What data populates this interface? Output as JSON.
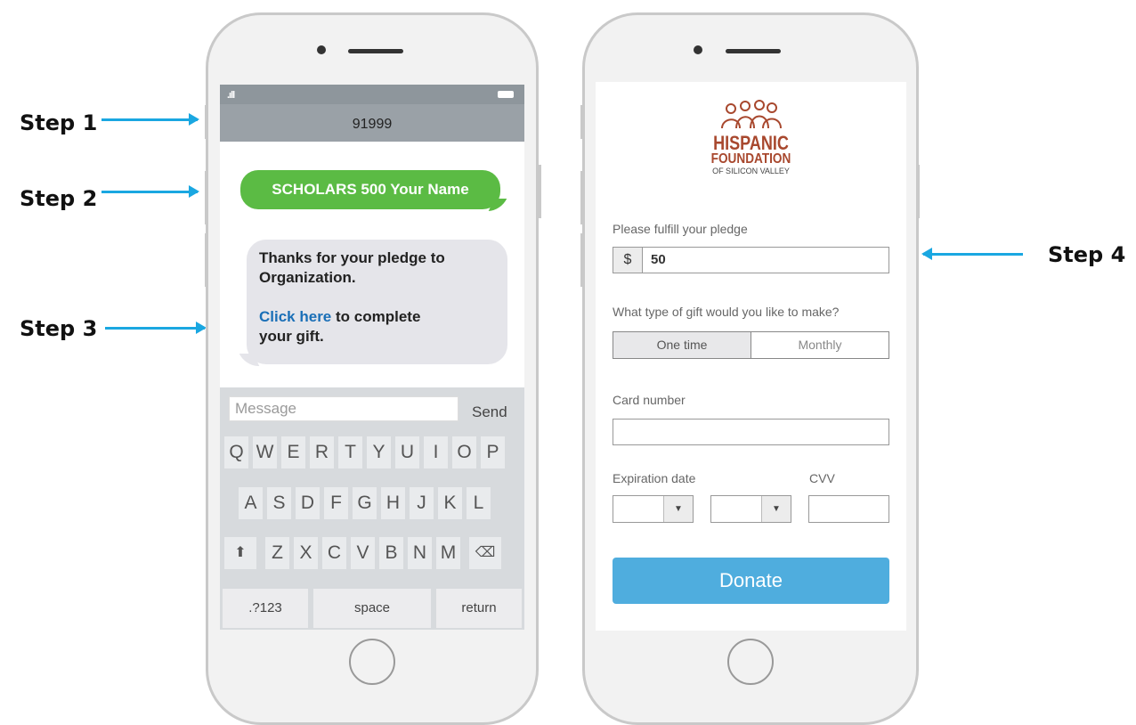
{
  "steps": [
    {
      "label": "Step 1"
    },
    {
      "label": "Step 2"
    },
    {
      "label": "Step 3"
    },
    {
      "label": "Step 4"
    }
  ],
  "sms_phone": {
    "contact": "91999",
    "sent_message": "SCHOLARS 500 Your Name",
    "reply_line1": "Thanks for your pledge to",
    "reply_line2": "Organization.",
    "reply_link": "Click here",
    "reply_rest1": "to complete",
    "reply_rest2": "your gift.",
    "input_placeholder": "Message",
    "send_label": "Send",
    "keyboard": {
      "row1": [
        "Q",
        "W",
        "E",
        "R",
        "T",
        "Y",
        "U",
        "I",
        "O",
        "P"
      ],
      "row2": [
        "A",
        "S",
        "D",
        "F",
        "G",
        "H",
        "J",
        "K",
        "L"
      ],
      "row3": [
        "Z",
        "X",
        "C",
        "V",
        "B",
        "N",
        "M"
      ],
      "numbers_key": ".?123",
      "space_key": "space",
      "return_key": "return"
    }
  },
  "donation_phone": {
    "logo": {
      "line1": "HISPANIC",
      "line2": "FOUNDATION",
      "line3": "OF SILICON VALLEY"
    },
    "pledge_label": "Please fulfill your pledge",
    "currency_symbol": "$",
    "amount": "50",
    "gift_type_label": "What type of gift would you like to make?",
    "gift_options": [
      "One time",
      "Monthly"
    ],
    "selected_gift": "One time",
    "card_label": "Card number",
    "expiration_label": "Expiration date",
    "cvv_label": "CVV",
    "donate_label": "Donate",
    "accent_color": "#4fadde"
  }
}
